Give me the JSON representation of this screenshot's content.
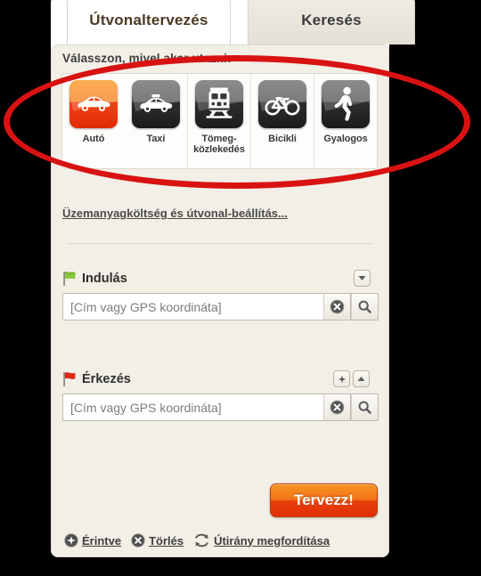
{
  "window": {
    "background_color": "#000000",
    "panel_background": "#f2efe6"
  },
  "tabs": [
    {
      "label": "Útvonaltervezés",
      "active": true,
      "name": "tab-route-planning"
    },
    {
      "label": "Keresés",
      "active": false,
      "name": "tab-search"
    }
  ],
  "mode_section": {
    "prompt": "Válasszon, mivel akar utazni:",
    "modes": [
      {
        "label": "Autó",
        "icon": "car-icon",
        "selected": true
      },
      {
        "label": "Taxi",
        "icon": "taxi-icon",
        "selected": false
      },
      {
        "label": "Tömeg-közlekedés",
        "label_line1": "Tömeg-",
        "label_line2": "közlekedés",
        "icon": "train-icon",
        "selected": false
      },
      {
        "label": "Bicikli",
        "icon": "bicycle-icon",
        "selected": false
      },
      {
        "label": "Gyalogos",
        "icon": "pedestrian-icon",
        "selected": false
      }
    ],
    "selected_color": "#ef4412"
  },
  "settings_link": {
    "label": "Üzemanyagköltség és útvonal-beállítás..."
  },
  "departure": {
    "title": "Indulás",
    "flag_icon": "green-flag-icon",
    "flag_color": "#8cc63e",
    "input_placeholder": "[Cím vagy GPS koordináta]",
    "input_value": "",
    "buttons": [
      {
        "name": "departure-options-button",
        "icon": "chevron-down-icon"
      }
    ],
    "field_buttons": [
      {
        "name": "departure-clear-button",
        "icon": "clear-circle-icon"
      },
      {
        "name": "departure-search-button",
        "icon": "search-icon"
      }
    ]
  },
  "arrival": {
    "title": "Érkezés",
    "flag_icon": "red-flag-icon",
    "flag_color": "#e02718",
    "input_placeholder": "[Cím vagy GPS koordináta]",
    "input_value": "",
    "buttons": [
      {
        "name": "arrival-add-button",
        "icon": "plus-icon"
      },
      {
        "name": "arrival-collapse-button",
        "icon": "chevron-up-icon"
      }
    ],
    "field_buttons": [
      {
        "name": "arrival-clear-button",
        "icon": "clear-circle-icon"
      },
      {
        "name": "arrival-search-button",
        "icon": "search-icon"
      }
    ]
  },
  "plan_button": {
    "label": "Tervezz!",
    "color": "#e8400b"
  },
  "bottom_links": [
    {
      "label": "Érintve",
      "icon": "plus-circle-icon",
      "name": "link-add-waypoint"
    },
    {
      "label": "Törlés",
      "icon": "x-circle-icon",
      "name": "link-clear"
    },
    {
      "label": "Útirány megfordítása",
      "icon": "swap-arrows-icon",
      "name": "link-reverse-route"
    }
  ],
  "annotation": {
    "shape": "ellipse",
    "color": "#d81212"
  }
}
